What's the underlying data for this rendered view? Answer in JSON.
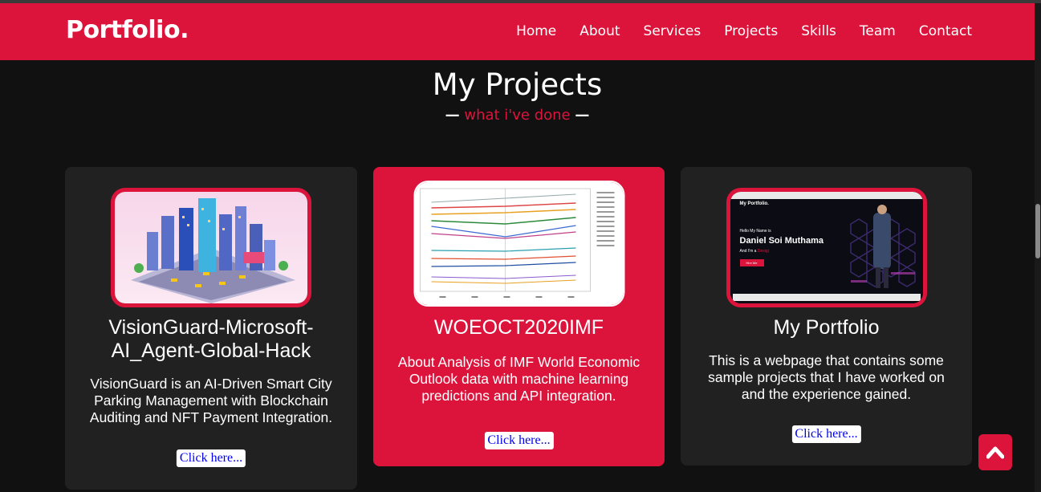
{
  "nav": {
    "logo": "Portfolio.",
    "links": [
      "Home",
      "About",
      "Services",
      "Projects",
      "Skills",
      "Team",
      "Contact"
    ]
  },
  "section": {
    "title": "My Projects",
    "subtitle": "what i've done",
    "dash": "—"
  },
  "projects": [
    {
      "title": "VisionGuard-Microsoft-AI_Agent-Global-Hack",
      "description": "VisionGuard is an AI-Driven Smart City Parking Management with Blockchain Auditing and NFT Payment Integration.",
      "link": "Click here..."
    },
    {
      "title": "WOEOCT2020IMF",
      "description": "About Analysis of IMF World Economic Outlook data with machine learning predictions and API integration.",
      "link": "Click here..."
    },
    {
      "title": "My Portfolio",
      "description": "This is a webpage that contains some sample projects that I have worked on and the experience gained.",
      "link": "Click here..."
    }
  ],
  "thumb3": {
    "logo": "My Portfolio.",
    "greeting": "Hello My Name is",
    "name": "Daniel Soi Muthama",
    "role_prefix": "And I'm a",
    "role": "Desig|",
    "button": "Hire Me"
  },
  "colors": {
    "accent": "#dc143c",
    "background": "#111111",
    "card": "#212121"
  },
  "icons": {
    "scroll_top": "chevron-up-icon"
  }
}
